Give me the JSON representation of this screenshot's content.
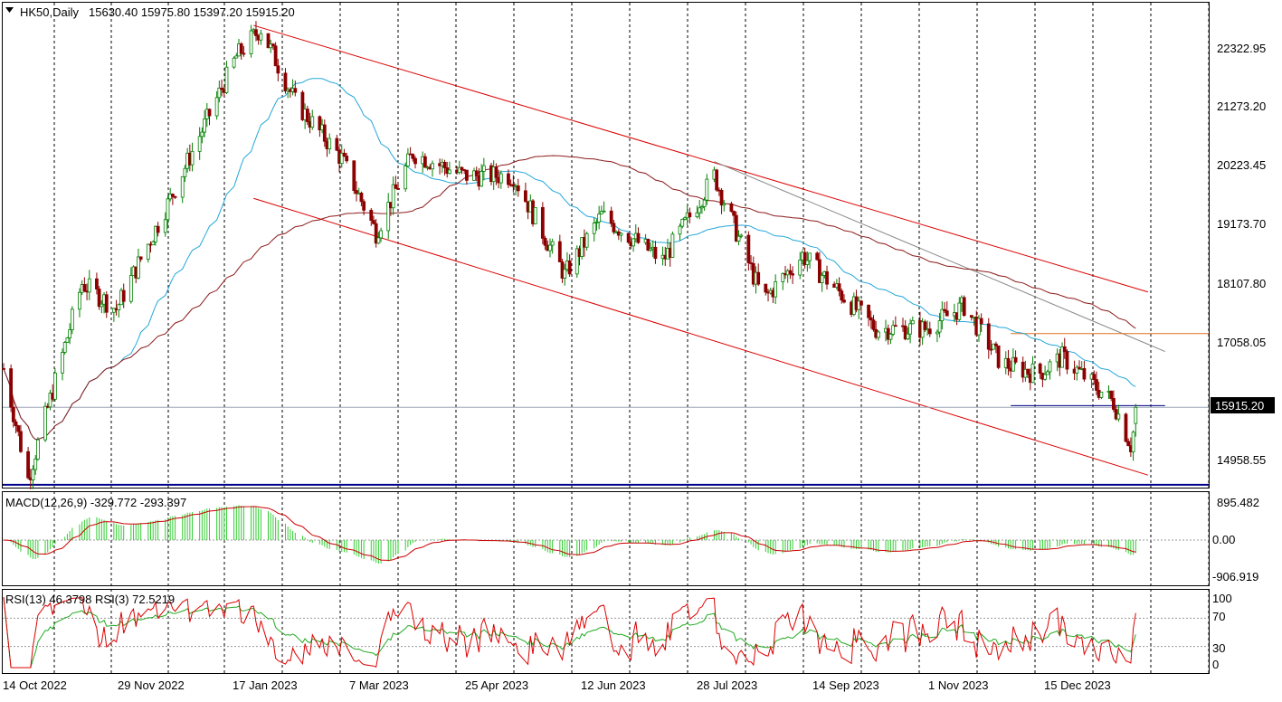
{
  "header": {
    "symbol_label": "HK50,Daily",
    "ohlc": "15630.40 15975.80 15397.20 15915.20",
    "menu_icon": "triangle-down-icon"
  },
  "price_axis": {
    "labels": [
      "22322.95",
      "21273.20",
      "20223.45",
      "19173.70",
      "18107.80",
      "17058.05",
      "14958.55"
    ],
    "current_price": "15915.20",
    "current_price_color": "#000000"
  },
  "macd": {
    "title": "MACD(12,26,9) -329.772 -293.397",
    "labels": [
      "895.482",
      "0.00",
      "-906.919"
    ]
  },
  "rsi": {
    "title": "RSI(13) 46.3798  RSI(3) 72.5219",
    "labels": [
      "100",
      "70",
      "30",
      "0"
    ]
  },
  "time_axis": {
    "labels": [
      "14 Oct 2022",
      "29 Nov 2022",
      "17 Jan 2023",
      "7 Mar 2023",
      "25 Apr 2023",
      "12 Jun 2023",
      "28 Jul 2023",
      "14 Sep 2023",
      "1 Nov 2023",
      "15 Dec 2023"
    ]
  },
  "colors": {
    "bull_candle": "#008000",
    "bear_candle": "#8b0000",
    "channel_line": "#dd0000",
    "ma_fast": "#25a7d9",
    "ma_slow": "#8b1a1a",
    "support_line": "#00008b",
    "resistance_line": "#e07020",
    "trend_line": "#888888",
    "macd_hist": "#32cd32",
    "macd_signal": "#cc0000",
    "rsi_fast": "#dd0000",
    "rsi_slow": "#22aa22"
  },
  "chart_data": {
    "type": "candlestick",
    "symbol": "HK50",
    "timeframe": "Daily",
    "last_bar": {
      "open": 15630.4,
      "high": 15975.8,
      "low": 15397.2,
      "close": 15915.2
    },
    "price_range": [
      14500,
      23050
    ],
    "x_range": [
      "2022-10-14",
      "2024-01-20"
    ],
    "key_points": [
      {
        "date": "2022-10-14",
        "close": 16600
      },
      {
        "date": "2022-10-24",
        "close": 14650
      },
      {
        "date": "2022-11-15",
        "close": 18100
      },
      {
        "date": "2022-11-29",
        "close": 17650
      },
      {
        "date": "2022-12-20",
        "close": 19500
      },
      {
        "date": "2023-01-17",
        "close": 22100
      },
      {
        "date": "2023-01-27",
        "close": 22600
      },
      {
        "date": "2023-02-10",
        "close": 21300
      },
      {
        "date": "2023-03-01",
        "close": 20300
      },
      {
        "date": "2023-03-15",
        "close": 19000
      },
      {
        "date": "2023-03-30",
        "close": 20400
      },
      {
        "date": "2023-04-20",
        "close": 20000
      },
      {
        "date": "2023-05-10",
        "close": 20000
      },
      {
        "date": "2023-05-31",
        "close": 18250
      },
      {
        "date": "2023-06-15",
        "close": 19300
      },
      {
        "date": "2023-07-10",
        "close": 18500
      },
      {
        "date": "2023-07-31",
        "close": 20000
      },
      {
        "date": "2023-08-20",
        "close": 17800
      },
      {
        "date": "2023-09-05",
        "close": 18600
      },
      {
        "date": "2023-10-05",
        "close": 17300
      },
      {
        "date": "2023-10-25",
        "close": 17300
      },
      {
        "date": "2023-11-10",
        "close": 17700
      },
      {
        "date": "2023-11-25",
        "close": 16700
      },
      {
        "date": "2023-12-10",
        "close": 16500
      },
      {
        "date": "2023-12-20",
        "close": 16800
      },
      {
        "date": "2024-01-10",
        "close": 16000
      },
      {
        "date": "2024-01-17",
        "close": 15250
      },
      {
        "date": "2024-01-20",
        "close": 15915.2
      }
    ],
    "indicators": [
      "MA fast",
      "MA slow",
      "MACD(12,26,9)",
      "RSI(13)",
      "RSI(3)"
    ],
    "horizontal_levels": [
      14550,
      15945,
      17215
    ],
    "rsi_levels": [
      70,
      30
    ],
    "grid": false
  }
}
